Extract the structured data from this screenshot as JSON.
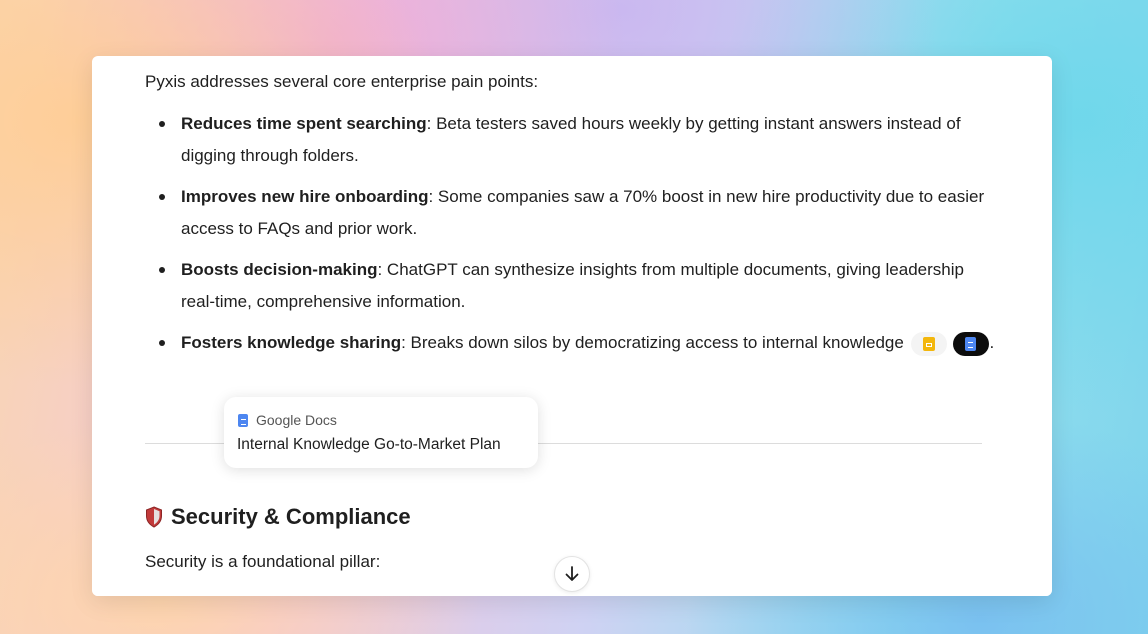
{
  "content": {
    "intro": "Pyxis addresses several core enterprise pain points:",
    "points": [
      {
        "term": "Reduces time spent searching",
        "text": ": Beta testers saved hours weekly by getting instant answers instead of digging through folders."
      },
      {
        "term": "Improves new hire onboarding",
        "text": ": Some companies saw a 70% boost in new hire productivity due to easier access to FAQs and prior work."
      },
      {
        "term": "Boosts decision-making",
        "text": ": ChatGPT can synthesize insights from multiple documents, giving leadership real-time, comprehensive information."
      },
      {
        "term": "Fosters knowledge sharing",
        "text": ": Breaks down silos by democratizing access to internal knowledge",
        "end": "."
      }
    ]
  },
  "citations": {
    "chips": [
      {
        "icon": "google-slides-icon",
        "color": "#f3b70d",
        "state": "default"
      },
      {
        "icon": "google-docs-icon",
        "color": "#4d86f0",
        "state": "active"
      }
    ],
    "tooltip": {
      "source_icon": "google-docs-icon",
      "source": "Google Docs",
      "title": "Internal Knowledge Go-to-Market Plan"
    }
  },
  "section": {
    "icon": "shield-icon",
    "title": "Security & Compliance",
    "body": "Security is a foundational pillar:"
  },
  "controls": {
    "scroll_icon": "arrow-down-icon"
  }
}
